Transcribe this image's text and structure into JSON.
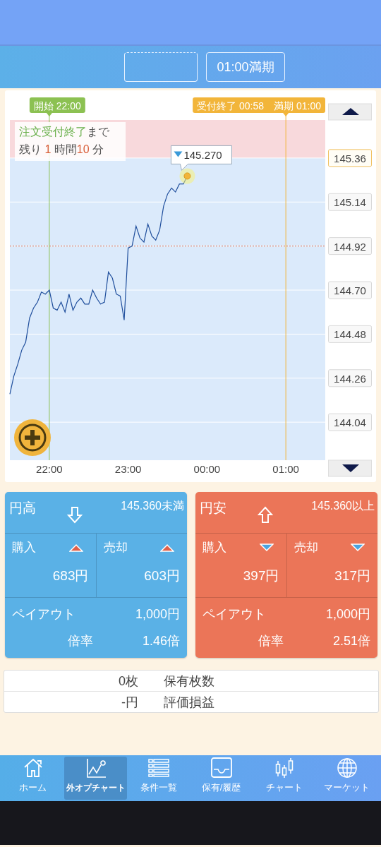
{
  "header": {
    "buttons": [
      {
        "kind": "blank"
      },
      {
        "kind": "text",
        "label": "01:00満期"
      }
    ]
  },
  "chart": {
    "countdown": {
      "lead": "注文受付終了",
      "lead_tail": "まで",
      "prefix": "残り",
      "hours": "1",
      "hours_unit": "時間",
      "minutes": "10",
      "minutes_unit": "分"
    },
    "markers": [
      {
        "label": "開始 22:00",
        "color": "#8cc152"
      },
      {
        "label": "受付終了 00:58　満期 01:00",
        "color": "#f2b53a"
      }
    ],
    "tooltip": {
      "label": "145.270"
    },
    "chart_data": {
      "type": "line",
      "categories": [
        null,
        null,
        null,
        null,
        null,
        null,
        null,
        null,
        null,
        null,
        "22:00",
        null,
        null,
        null,
        null,
        null,
        null,
        null,
        null,
        null,
        null,
        null,
        null,
        null,
        null,
        null,
        null,
        null,
        null,
        null,
        "23:00",
        null,
        null,
        null,
        null,
        null,
        null,
        null,
        null,
        null,
        null,
        null,
        null,
        null,
        null,
        null,
        null,
        null,
        null,
        null,
        "00:00",
        null,
        null,
        null,
        null,
        null,
        null,
        null,
        null,
        null,
        null,
        null,
        null,
        null,
        null,
        null,
        null,
        null,
        null,
        null,
        "01:00",
        null,
        null,
        null,
        null,
        null,
        null,
        null,
        null,
        null,
        null
      ],
      "series": [
        {
          "color": "#1f4e9c",
          "values": [
            144.18,
            144.27,
            144.33,
            144.4,
            144.44,
            144.56,
            144.61,
            144.64,
            144.69,
            144.68,
            144.7,
            144.61,
            144.6,
            144.64,
            144.59,
            144.68,
            144.6,
            144.64,
            144.66,
            144.63,
            144.63,
            144.7,
            144.66,
            144.63,
            144.64,
            144.79,
            144.76,
            144.68,
            144.67,
            144.55,
            144.91,
            144.92,
            145.02,
            144.96,
            144.94,
            145.03,
            144.97,
            144.95,
            145.0,
            145.12,
            145.18,
            145.21,
            145.19,
            145.23,
            145.23,
            145.27,
            null,
            null,
            null,
            null,
            null,
            null,
            null,
            null,
            null,
            null,
            null,
            null,
            null,
            null,
            null,
            null,
            null,
            null,
            null,
            null,
            null,
            null,
            null,
            null,
            null,
            null,
            null,
            null,
            null,
            null,
            null,
            null,
            null,
            null,
            null
          ]
        }
      ],
      "ylim": [
        143.85,
        145.55
      ],
      "grid": true,
      "ref_lines": [
        {
          "axis": "y",
          "value": 144.92
        }
      ],
      "bands": [
        {
          "axis": "y",
          "from": 145.36,
          "to": 145.55
        }
      ],
      "yticks": [
        {
          "value": 145.36,
          "label": "145.36"
        },
        {
          "value": 145.14,
          "label": "145.14"
        },
        {
          "value": 144.92,
          "label": "144.92"
        },
        {
          "value": 144.7,
          "label": "144.70"
        },
        {
          "value": 144.48,
          "label": "144.48"
        },
        {
          "value": 144.26,
          "label": "144.26"
        },
        {
          "value": 144.04,
          "label": "144.04"
        }
      ]
    }
  },
  "options": [
    {
      "kind": "down",
      "color": "#5ab1e6",
      "title": "円高",
      "condition": "145.360未満",
      "cells": [
        {
          "label": "購入",
          "value": "683円",
          "kind": "up"
        },
        {
          "label": "売却",
          "value": "603円",
          "kind": "up"
        }
      ],
      "payout_label": "ペイアウト",
      "payout": "1,000円",
      "rate_label": "倍率",
      "rate": "1.46倍"
    },
    {
      "kind": "up",
      "color": "#eb7558",
      "title": "円安",
      "condition": "145.360以上",
      "cells": [
        {
          "label": "購入",
          "value": "397円",
          "kind": "down"
        },
        {
          "label": "売却",
          "value": "317円",
          "kind": "down"
        }
      ],
      "payout_label": "ペイアウト",
      "payout": "1,000円",
      "rate_label": "倍率",
      "rate": "2.51倍"
    }
  ],
  "holdings": [
    {
      "value": "0枚",
      "label": "保有枚数"
    },
    {
      "value": "-円",
      "label": "評価損益"
    }
  ],
  "nav": [
    {
      "kind": "home",
      "label": "ホーム",
      "selected": false
    },
    {
      "kind": "line-chart",
      "label": "外オプチャート",
      "selected": true
    },
    {
      "kind": "list",
      "label": "条件一覧",
      "selected": false
    },
    {
      "kind": "tray",
      "label": "保有/履歴",
      "selected": false
    },
    {
      "kind": "candles",
      "label": "チャート",
      "selected": false
    },
    {
      "kind": "globe",
      "label": "マーケット",
      "selected": false
    }
  ]
}
